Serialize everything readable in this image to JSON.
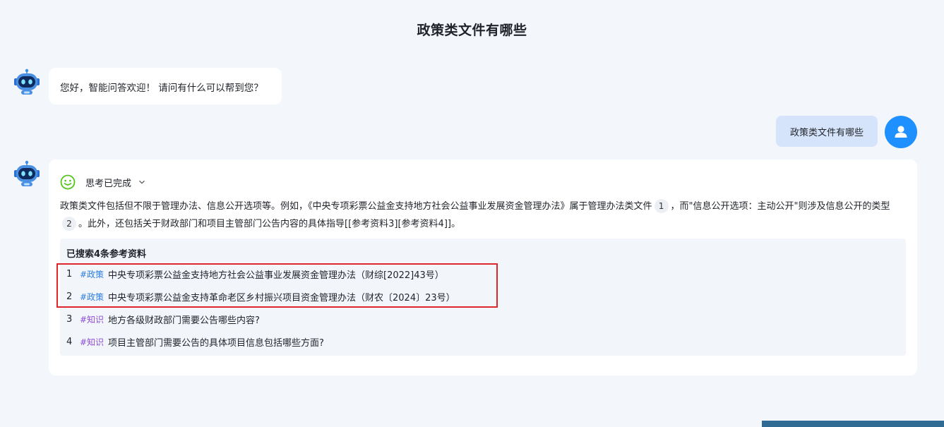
{
  "page": {
    "title": "政策类文件有哪些"
  },
  "greeting": {
    "text": "您好，智能问答欢迎！ 请问有什么可以帮到您？"
  },
  "user_message": {
    "text": "政策类文件有哪些"
  },
  "answer": {
    "thinking_label": "思考已完成",
    "segment_1": "政策类文件包括但不限于管理办法、信息公开选项等。例如，《中央专项彩票公益金支持地方社会公益事业发展资金管理办法》属于管理办法类文件",
    "ref_1": "1",
    "segment_2": "，而\"信息公开选项：主动公开\"则涉及信息公开的类型",
    "ref_2": "2",
    "segment_3": "。此外，还包括关于财政部门和项目主管部门公告内容的具体指导[[参考资料3][参考资料4]]。",
    "refs_title": "已搜索4条参考资料",
    "references": [
      {
        "index": "1",
        "tag": "#政策",
        "title": "中央专项彩票公益金支持地方社会公益事业发展资金管理办法（财综[2022]43号）"
      },
      {
        "index": "2",
        "tag": "#政策",
        "title": "中央专项彩票公益金支持革命老区乡村振兴项目资金管理办法（财农〔2024〕23号）"
      },
      {
        "index": "3",
        "tag": "#知识",
        "title": "地方各级财政部门需要公告哪些内容?"
      },
      {
        "index": "4",
        "tag": "#知识",
        "title": "项目主管部门需要公告的具体项目信息包括哪些方面?"
      }
    ]
  },
  "icons": {
    "bot": "robot-avatar-icon",
    "user": "user-avatar-icon",
    "thinking": "smiley-icon",
    "toggle": "chevron-down-icon"
  },
  "colors": {
    "background": "#f3f6fb",
    "user_bubble": "#d6e4fb",
    "user_avatar": "#1e90ff",
    "policy_tag": "#2f7fe0",
    "knowledge_tag": "#8f4fd6",
    "highlight": "#e0262d",
    "thinking_icon": "#52c41a"
  }
}
